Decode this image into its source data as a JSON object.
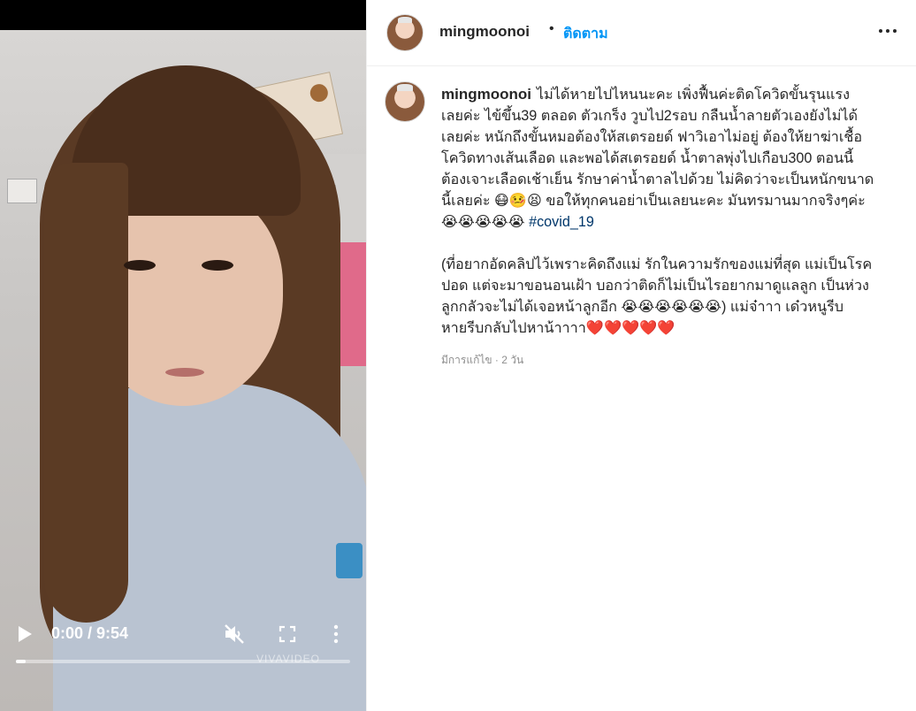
{
  "video": {
    "time_label": "0:00 / 9:54",
    "progress": 0.03,
    "watermark": "VIVAVIDEO"
  },
  "header": {
    "username": "mingmoonoi",
    "separator": "•",
    "follow_label": "ติดตาม"
  },
  "caption": {
    "username": "mingmoonoi",
    "paragraph1_lines": [
      "ไม่ได้หายไปไหนนะคะ เพิ่งฟื้นค่ะติดโควิดขั้นรุนแรง",
      "เลยค่ะ ไข้ขึ้น39 ตลอด ตัวเกร็ง วูบไป2รอบ กลืนน้ำลายตัวเองยังไม่ได้",
      "เลยค่ะ หนักถึงขั้นหมอต้องให้สเตรอยด์ ฟาวิเอาไม่อยู่ ต้องให้ยาฆ่าเชื้อ",
      "โควิดทางเส้นเลือด และพอได้สเตรอยด์ น้ำตาลพุ่งไปเกือบ300 ตอนนี้",
      "ต้องเจาะเลือดเช้าเย็น รักษาค่าน้ำตาลไปด้วย ไม่คิดว่าจะเป็นหนักขนาด",
      "นี้เลยค่ะ 😷🤒😫 ขอให้ทุกคนอย่าเป็นเลยนะคะ มันทรมานมากจริงๆค่ะ",
      "😭😭😭😭😭"
    ],
    "hashtag": "#covid_19",
    "paragraph2_lines": [
      "(ที่อยากอัดคลิปไว้เพราะคิดถึงแม่ รักในความรักของแม่ที่สุด แม่เป็นโรค",
      "ปอด แต่จะมาขอนอนเฝ้า บอกว่าติดก็ไม่เป็นไรอยากมาดูแลลูก เป็นห่วง",
      "ลูกกลัวจะไม่ได้เจอหน้าลูกอีก 😭😭😭😭😭😭) แม่จ๋าาา เด๋วหนูรีบ",
      "หายรีบกลับไปหาน้าาาา❤️❤️❤️❤️❤️"
    ]
  },
  "meta": {
    "edited_label": "มีการแก้ไข · 2 วัน"
  }
}
